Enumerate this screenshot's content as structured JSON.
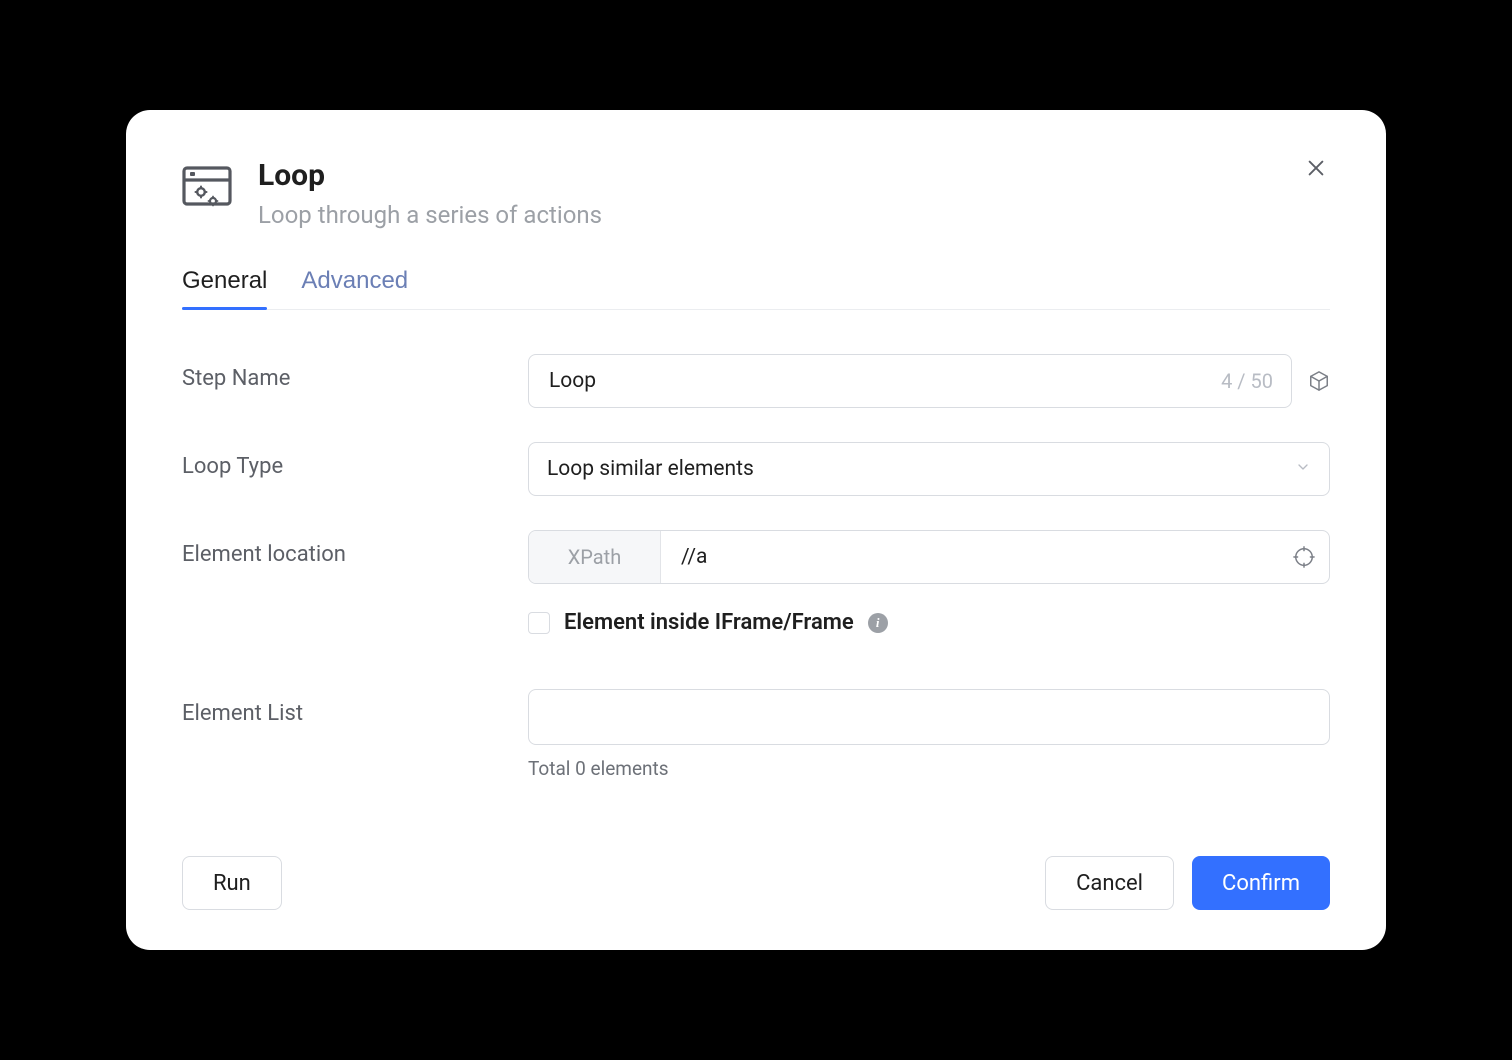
{
  "header": {
    "title": "Loop",
    "subtitle": "Loop through a series of actions"
  },
  "tabs": {
    "general": "General",
    "advanced": "Advanced"
  },
  "form": {
    "step_name": {
      "label": "Step Name",
      "value": "Loop",
      "char_count": "4 / 50"
    },
    "loop_type": {
      "label": "Loop Type",
      "value": "Loop similar elements"
    },
    "element_location": {
      "label": "Element location",
      "prefix": "XPath",
      "value": "//a"
    },
    "iframe_checkbox": {
      "label": "Element inside IFrame/Frame",
      "checked": false
    },
    "element_list": {
      "label": "Element List",
      "helper": "Total 0 elements"
    }
  },
  "footer": {
    "run": "Run",
    "cancel": "Cancel",
    "confirm": "Confirm"
  }
}
